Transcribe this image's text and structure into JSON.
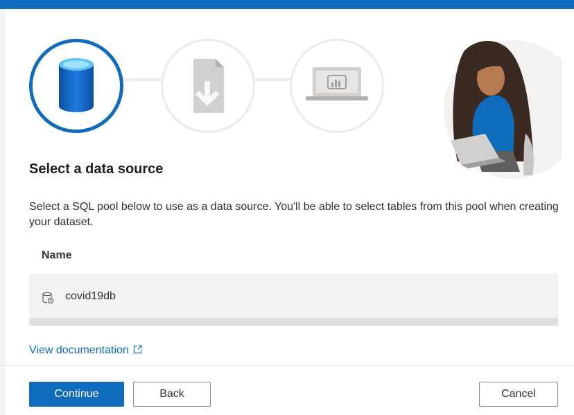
{
  "wizard": {
    "steps": [
      {
        "icon": "database-icon",
        "state": "active"
      },
      {
        "icon": "document-download-icon",
        "state": "inactive"
      },
      {
        "icon": "laptop-chart-icon",
        "state": "inactive"
      }
    ],
    "illustration": "person-with-laptop-illustration"
  },
  "page": {
    "title": "Select a data source",
    "description": "Select a SQL pool below to use as a data source. You'll be able to select tables from this pool when creating your dataset."
  },
  "table": {
    "column_header": "Name",
    "rows": [
      {
        "icon": "sql-pool-icon",
        "label": "covid19db"
      }
    ]
  },
  "link": {
    "label": "View documentation",
    "icon": "external-link-icon"
  },
  "footer": {
    "continue_label": "Continue",
    "back_label": "Back",
    "cancel_label": "Cancel"
  },
  "colors": {
    "accent": "#0f6cbd",
    "row_background": "#f3f2f1"
  }
}
